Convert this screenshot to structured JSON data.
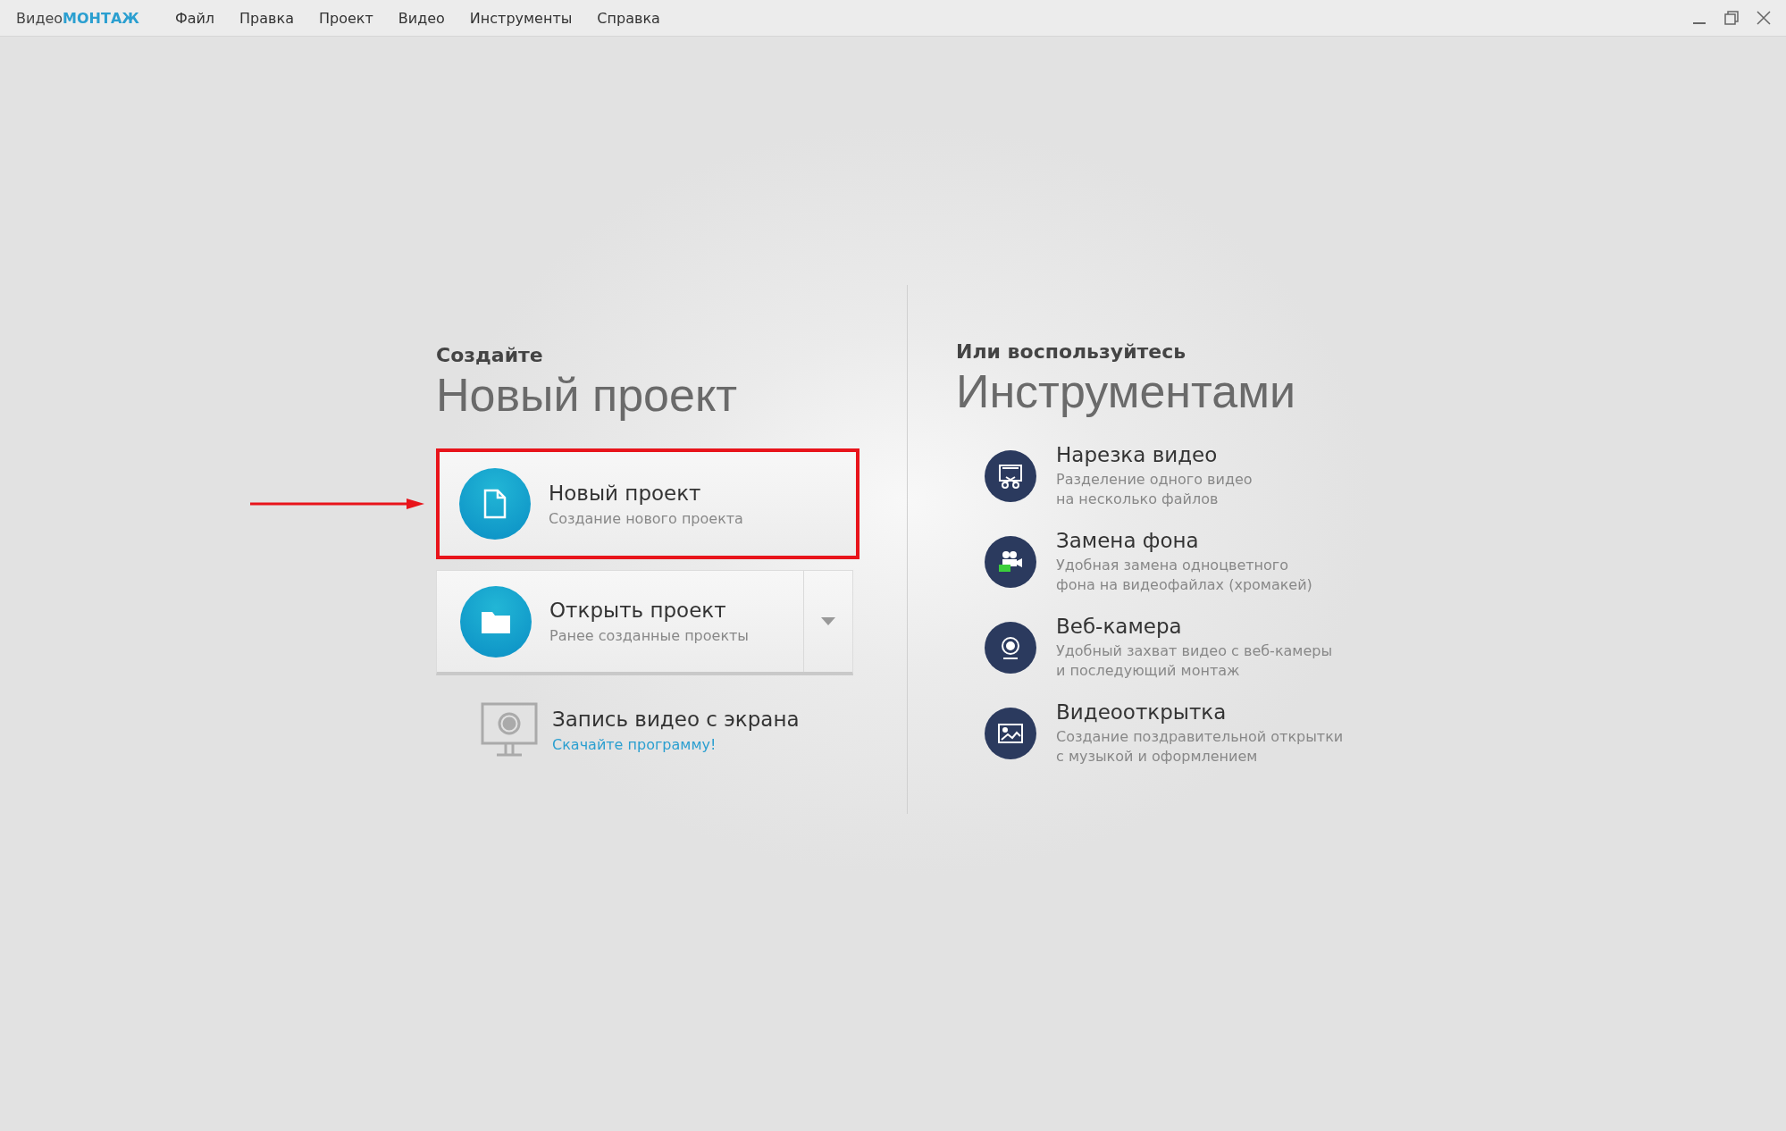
{
  "logo": {
    "prefix": "Видео",
    "accent": "МОНТАЖ"
  },
  "menu": [
    "Файл",
    "Правка",
    "Проект",
    "Видео",
    "Инструменты",
    "Справка"
  ],
  "create": {
    "kicker": "Создайте",
    "title": "Новый проект",
    "actions": [
      {
        "kind": "new",
        "title": "Новый проект",
        "subtitle": "Создание нового проекта",
        "highlighted": true
      },
      {
        "kind": "open",
        "title": "Открыть проект",
        "subtitle": "Ранее созданные проекты",
        "highlighted": false
      }
    ],
    "recorder": {
      "title": "Запись видео с экрана",
      "link": "Скачайте программу!"
    }
  },
  "tools": {
    "kicker": "Или воспользуйтесь",
    "title": "Инструментами",
    "items": [
      {
        "kind": "cut",
        "title": "Нарезка видео",
        "subtitle": [
          "Разделение одного видео",
          "на несколько файлов"
        ]
      },
      {
        "kind": "chroma",
        "title": "Замена фона",
        "subtitle": [
          "Удобная замена одноцветного",
          "фона на видеофайлах (хромакей)"
        ]
      },
      {
        "kind": "webcam",
        "title": "Веб-камера",
        "subtitle": [
          "Удобный захват видео с веб-камеры",
          "и последующий монтаж"
        ]
      },
      {
        "kind": "card",
        "title": "Видеооткрытка",
        "subtitle": [
          "Создание поздравительной открытки",
          "с музыкой и оформлением"
        ]
      }
    ]
  }
}
